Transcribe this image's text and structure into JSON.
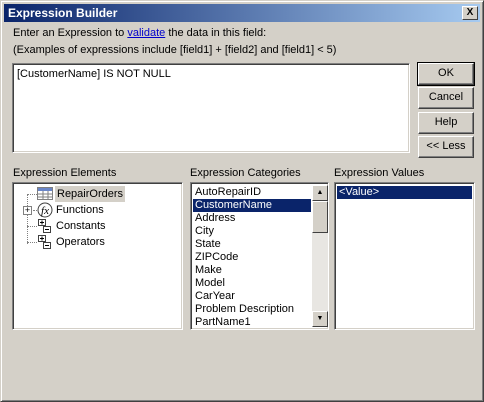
{
  "window": {
    "title": "Expression Builder",
    "close_glyph": "X"
  },
  "instructions": {
    "line1_prefix": "Enter an Expression to ",
    "line1_link": "validate",
    "line1_suffix": " the data in this field:",
    "line2": "(Examples of expressions include [field1] + [field2] and [field1] < 5)"
  },
  "expression": {
    "value": "[CustomerName] IS NOT NULL"
  },
  "buttons": {
    "ok": "OK",
    "cancel": "Cancel",
    "help": "Help",
    "less": "<< Less"
  },
  "elements": {
    "label": "Expression Elements",
    "items": [
      {
        "label": "RepairOrders",
        "icon": "table-icon",
        "selected": true
      },
      {
        "label": "Functions",
        "icon": "function-icon",
        "expandable": true
      },
      {
        "label": "Constants",
        "icon": "constants-icon"
      },
      {
        "label": "Operators",
        "icon": "operators-icon"
      }
    ]
  },
  "categories": {
    "label": "Expression Categories",
    "items": [
      "AutoRepairID",
      "CustomerName",
      "Address",
      "City",
      "State",
      "ZIPCode",
      "Make",
      "Model",
      "CarYear",
      "Problem Description",
      "PartName1"
    ],
    "selected_index": 1
  },
  "values": {
    "label": "Expression Values",
    "items": [
      "<Value>"
    ],
    "selected_index": 0
  },
  "colors": {
    "face": "#d4d0c8",
    "titlebar": "#0a246a",
    "selection": "#0a246a",
    "link": "#0000cc"
  }
}
